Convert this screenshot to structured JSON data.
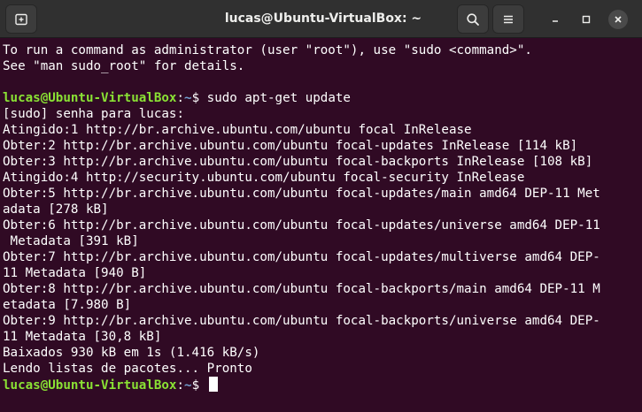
{
  "window": {
    "title": "lucas@Ubuntu-VirtualBox: ~",
    "controls": {
      "new_tab_icon": "new-tab-icon",
      "search_icon": "search-icon",
      "menu_icon": "hamburger-menu-icon",
      "minimize_icon": "minimize-icon",
      "maximize_icon": "maximize-icon",
      "close_icon": "close-icon"
    }
  },
  "colors": {
    "terminal_bg": "#300a24",
    "prompt_user": "#8ae234",
    "prompt_path": "#729fcf",
    "text": "#ffffff",
    "headerbar": "#303030"
  },
  "terminal": {
    "lines": [
      {
        "type": "text",
        "text": "To run a command as administrator (user \"root\"), use \"sudo <command>\"."
      },
      {
        "type": "text",
        "text": "See \"man sudo_root\" for details."
      },
      {
        "type": "text",
        "text": ""
      },
      {
        "type": "prompt",
        "user": "lucas@Ubuntu-VirtualBox",
        "sep": ":",
        "path": "~",
        "sym": "$ ",
        "cmd": "sudo apt-get update"
      },
      {
        "type": "text",
        "text": "[sudo] senha para lucas: "
      },
      {
        "type": "text",
        "text": "Atingido:1 http://br.archive.ubuntu.com/ubuntu focal InRelease"
      },
      {
        "type": "text",
        "text": "Obter:2 http://br.archive.ubuntu.com/ubuntu focal-updates InRelease [114 kB]"
      },
      {
        "type": "text",
        "text": "Obter:3 http://br.archive.ubuntu.com/ubuntu focal-backports InRelease [108 kB]"
      },
      {
        "type": "text",
        "text": "Atingido:4 http://security.ubuntu.com/ubuntu focal-security InRelease"
      },
      {
        "type": "text",
        "text": "Obter:5 http://br.archive.ubuntu.com/ubuntu focal-updates/main amd64 DEP-11 Met"
      },
      {
        "type": "text",
        "text": "adata [278 kB]"
      },
      {
        "type": "text",
        "text": "Obter:6 http://br.archive.ubuntu.com/ubuntu focal-updates/universe amd64 DEP-11"
      },
      {
        "type": "text",
        "text": " Metadata [391 kB]"
      },
      {
        "type": "text",
        "text": "Obter:7 http://br.archive.ubuntu.com/ubuntu focal-updates/multiverse amd64 DEP-"
      },
      {
        "type": "text",
        "text": "11 Metadata [940 B]"
      },
      {
        "type": "text",
        "text": "Obter:8 http://br.archive.ubuntu.com/ubuntu focal-backports/main amd64 DEP-11 M"
      },
      {
        "type": "text",
        "text": "etadata [7.980 B]"
      },
      {
        "type": "text",
        "text": "Obter:9 http://br.archive.ubuntu.com/ubuntu focal-backports/universe amd64 DEP-"
      },
      {
        "type": "text",
        "text": "11 Metadata [30,8 kB]"
      },
      {
        "type": "text",
        "text": "Baixados 930 kB em 1s (1.416 kB/s)"
      },
      {
        "type": "text",
        "text": "Lendo listas de pacotes... Pronto"
      },
      {
        "type": "prompt",
        "user": "lucas@Ubuntu-VirtualBox",
        "sep": ":",
        "path": "~",
        "sym": "$ ",
        "cmd": "",
        "cursor": true
      }
    ]
  }
}
